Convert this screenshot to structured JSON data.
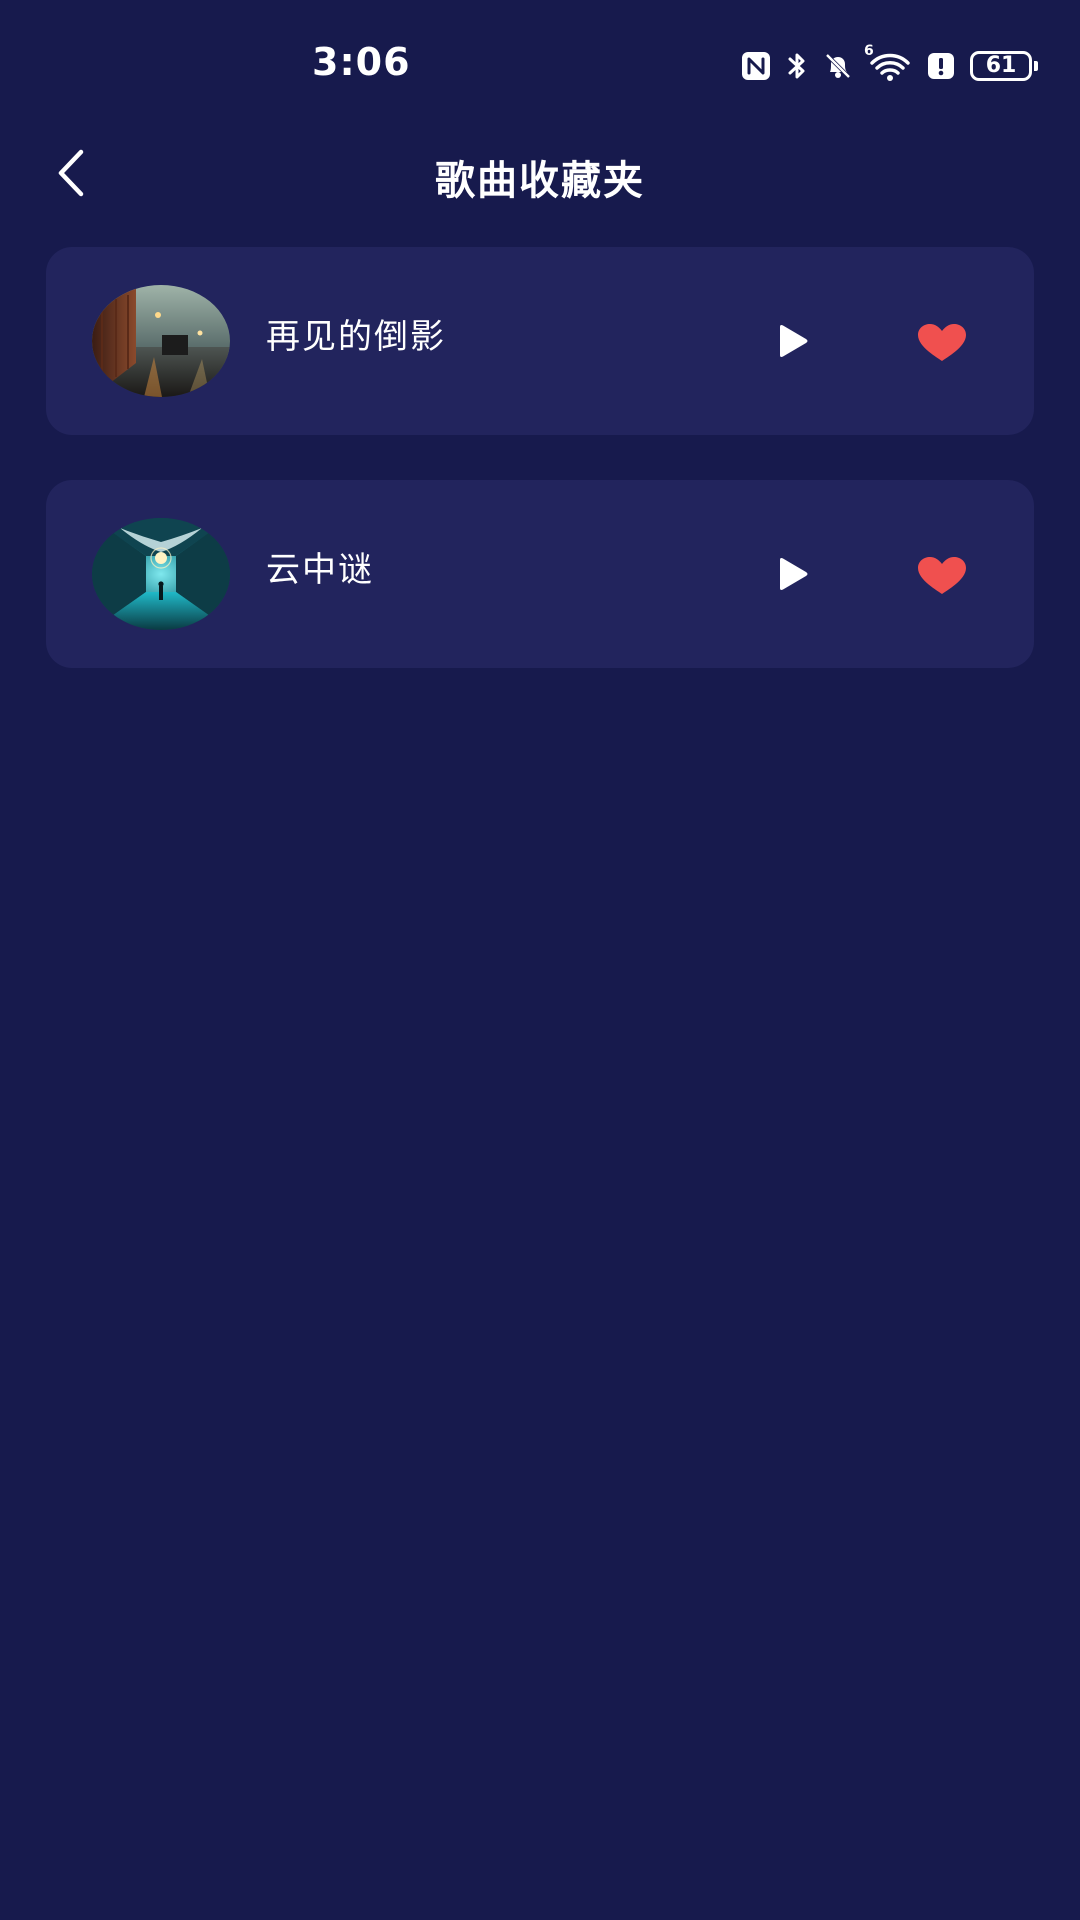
{
  "status_bar": {
    "time": "3:06",
    "battery_level": "61",
    "icons": [
      "nfc-icon",
      "bluetooth-icon",
      "bell-muted-icon",
      "wifi-6-icon",
      "alert-icon",
      "battery-icon"
    ],
    "wifi_label": "6"
  },
  "header": {
    "title": "歌曲收藏夹",
    "back_icon": "chevron-left-icon"
  },
  "songs": [
    {
      "title": "再见的倒影",
      "cover": "rainy-street-night-cover",
      "play_icon": "play-icon",
      "favorite_icon": "heart-icon",
      "favorited": true
    },
    {
      "title": "云中谜",
      "cover": "cloud-corridor-cover",
      "play_icon": "play-icon",
      "favorite_icon": "heart-icon",
      "favorited": true
    }
  ],
  "colors": {
    "background": "#171a4d",
    "card": "#22245d",
    "heart": "#f0504f",
    "text": "#ffffff"
  }
}
